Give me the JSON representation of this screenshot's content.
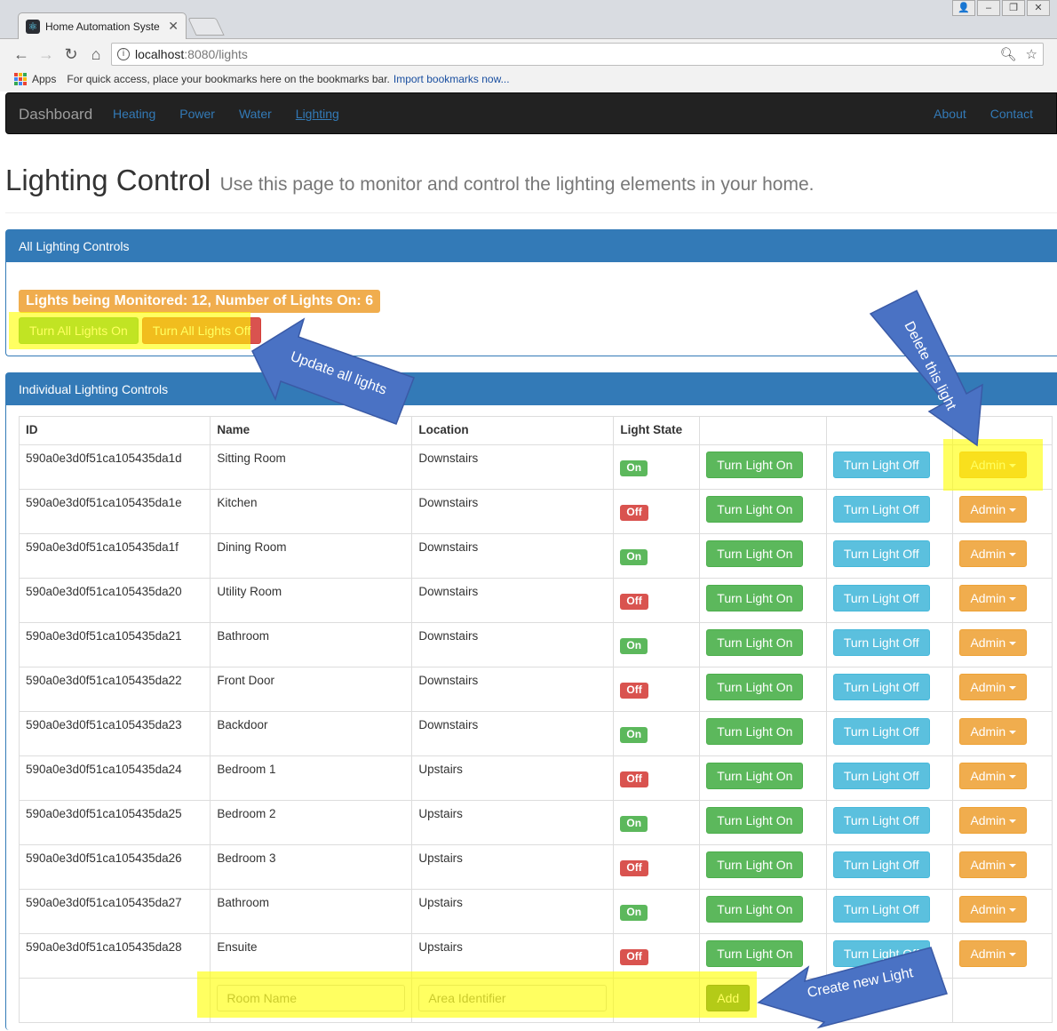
{
  "browser": {
    "tab_title": "Home Automation Syste",
    "url_host": "localhost",
    "url_rest": ":8080/lights",
    "bookmarks_apps": "Apps",
    "bookmarks_text": "For quick access, place your bookmarks here on the bookmarks bar.",
    "bookmarks_link": "Import bookmarks now..."
  },
  "navbar": {
    "brand": "Dashboard",
    "left_links": [
      "Heating",
      "Power",
      "Water",
      "Lighting"
    ],
    "active_link": "Lighting",
    "right_links": [
      "About",
      "Contact"
    ]
  },
  "page": {
    "title": "Lighting Control",
    "subtitle": "Use this page to monitor and control the lighting elements in your home."
  },
  "all_panel": {
    "heading": "All Lighting Controls",
    "status": "Lights being Monitored: 12, Number of Lights On: 6",
    "turn_all_on": "Turn All Lights On",
    "turn_all_off": "Turn All Lights Off"
  },
  "individual_panel": {
    "heading": "Individual Lighting Controls",
    "columns": [
      "ID",
      "Name",
      "Location",
      "Light State"
    ],
    "rows": [
      {
        "id": "590a0e3d0f51ca105435da1d",
        "name": "Sitting Room",
        "location": "Downstairs",
        "state": "On"
      },
      {
        "id": "590a0e3d0f51ca105435da1e",
        "name": "Kitchen",
        "location": "Downstairs",
        "state": "Off"
      },
      {
        "id": "590a0e3d0f51ca105435da1f",
        "name": "Dining Room",
        "location": "Downstairs",
        "state": "On"
      },
      {
        "id": "590a0e3d0f51ca105435da20",
        "name": "Utility Room",
        "location": "Downstairs",
        "state": "Off"
      },
      {
        "id": "590a0e3d0f51ca105435da21",
        "name": "Bathroom",
        "location": "Downstairs",
        "state": "On"
      },
      {
        "id": "590a0e3d0f51ca105435da22",
        "name": "Front Door",
        "location": "Downstairs",
        "state": "Off"
      },
      {
        "id": "590a0e3d0f51ca105435da23",
        "name": "Backdoor",
        "location": "Downstairs",
        "state": "On"
      },
      {
        "id": "590a0e3d0f51ca105435da24",
        "name": "Bedroom 1",
        "location": "Upstairs",
        "state": "Off"
      },
      {
        "id": "590a0e3d0f51ca105435da25",
        "name": "Bedroom 2",
        "location": "Upstairs",
        "state": "On"
      },
      {
        "id": "590a0e3d0f51ca105435da26",
        "name": "Bedroom 3",
        "location": "Upstairs",
        "state": "Off"
      },
      {
        "id": "590a0e3d0f51ca105435da27",
        "name": "Bathroom",
        "location": "Upstairs",
        "state": "On"
      },
      {
        "id": "590a0e3d0f51ca105435da28",
        "name": "Ensuite",
        "location": "Upstairs",
        "state": "Off"
      }
    ],
    "turn_on_label": "Turn Light On",
    "turn_off_label": "Turn Light Off",
    "admin_label": "Admin",
    "room_placeholder": "Room Name",
    "area_placeholder": "Area Identifier",
    "add_label": "Add"
  },
  "annotations": {
    "update_all": "Update all lights",
    "delete_light": "Delete this light",
    "create_light": "Create new Light"
  },
  "colors": {
    "primary": "#337ab7",
    "success": "#5cb85c",
    "danger": "#d9534f",
    "info": "#5bc0de",
    "warning": "#f0ad4e",
    "highlight": "#ffff00",
    "callout": "#4a72c4"
  }
}
